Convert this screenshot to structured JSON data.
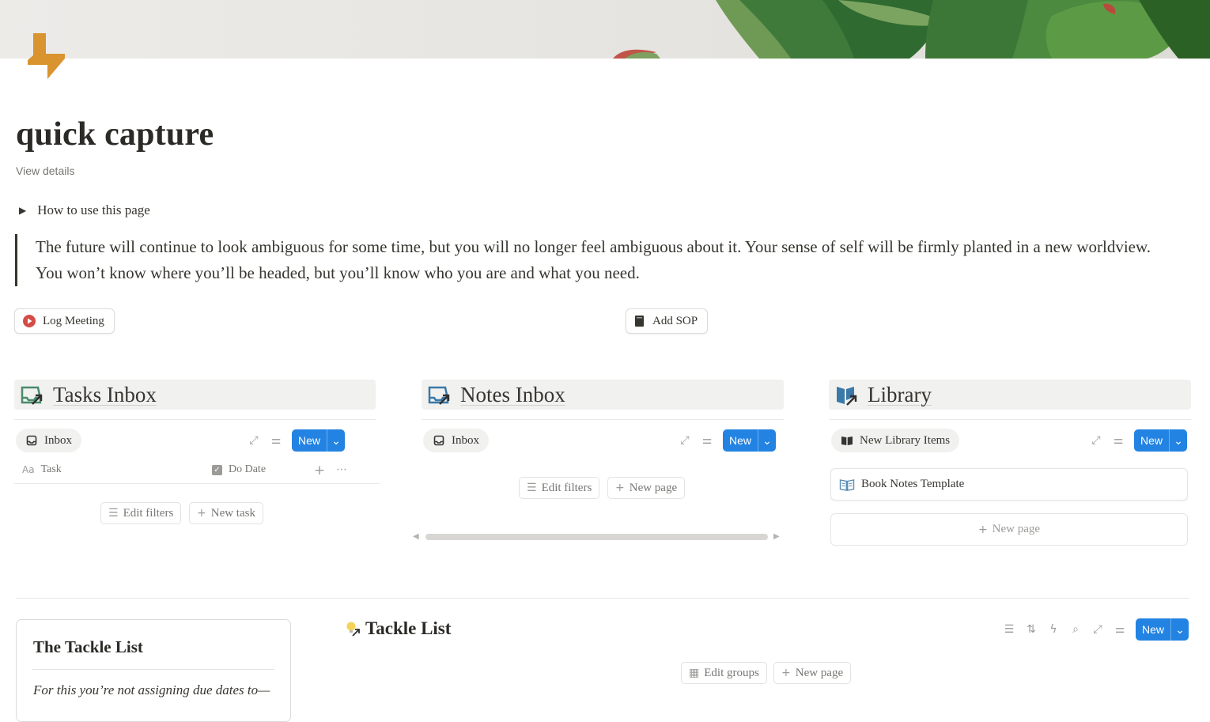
{
  "page": {
    "title": "quick capture",
    "view_details": "View details",
    "toggle_label": "How to use this page",
    "quote": "The future will continue to look ambiguous for some time, but you will no longer feel ambiguous about it. Your sense of self will be firmly planted in a new worldview. You won’t know where you’ll be headed, but you’ll know who you are and what you need."
  },
  "buttons": {
    "log_meeting": "Log Meeting",
    "add_sop": "Add SOP"
  },
  "tasks_inbox": {
    "title": "Tasks Inbox",
    "view_tab": "Inbox",
    "new_label": "New",
    "col_task": "Task",
    "col_do_date": "Do Date",
    "edit_filters": "Edit filters",
    "new_task": "New task"
  },
  "notes_inbox": {
    "title": "Notes Inbox",
    "view_tab": "Inbox",
    "new_label": "New",
    "edit_filters": "Edit filters",
    "new_page": "New page"
  },
  "library": {
    "title": "Library",
    "view_tab": "New Library Items",
    "new_label": "New",
    "item": "Book Notes Template",
    "new_page": "New page"
  },
  "tackle_card": {
    "heading": "The Tackle List",
    "body": "For this you’re not assigning due dates to—"
  },
  "tackle_list": {
    "title": "Tackle List",
    "new_label": "New",
    "edit_groups": "Edit groups",
    "new_page": "New page"
  },
  "colors": {
    "accent_blue": "#2383e2",
    "bolt_orange": "#d9932f",
    "text": "#37352f",
    "muted": "#787774",
    "tasks_icon_green": "#4a8a6b",
    "notes_icon_blue": "#3a79a8",
    "library_icon_blue": "#3a79a8",
    "log_meeting_red": "#d44c47"
  }
}
